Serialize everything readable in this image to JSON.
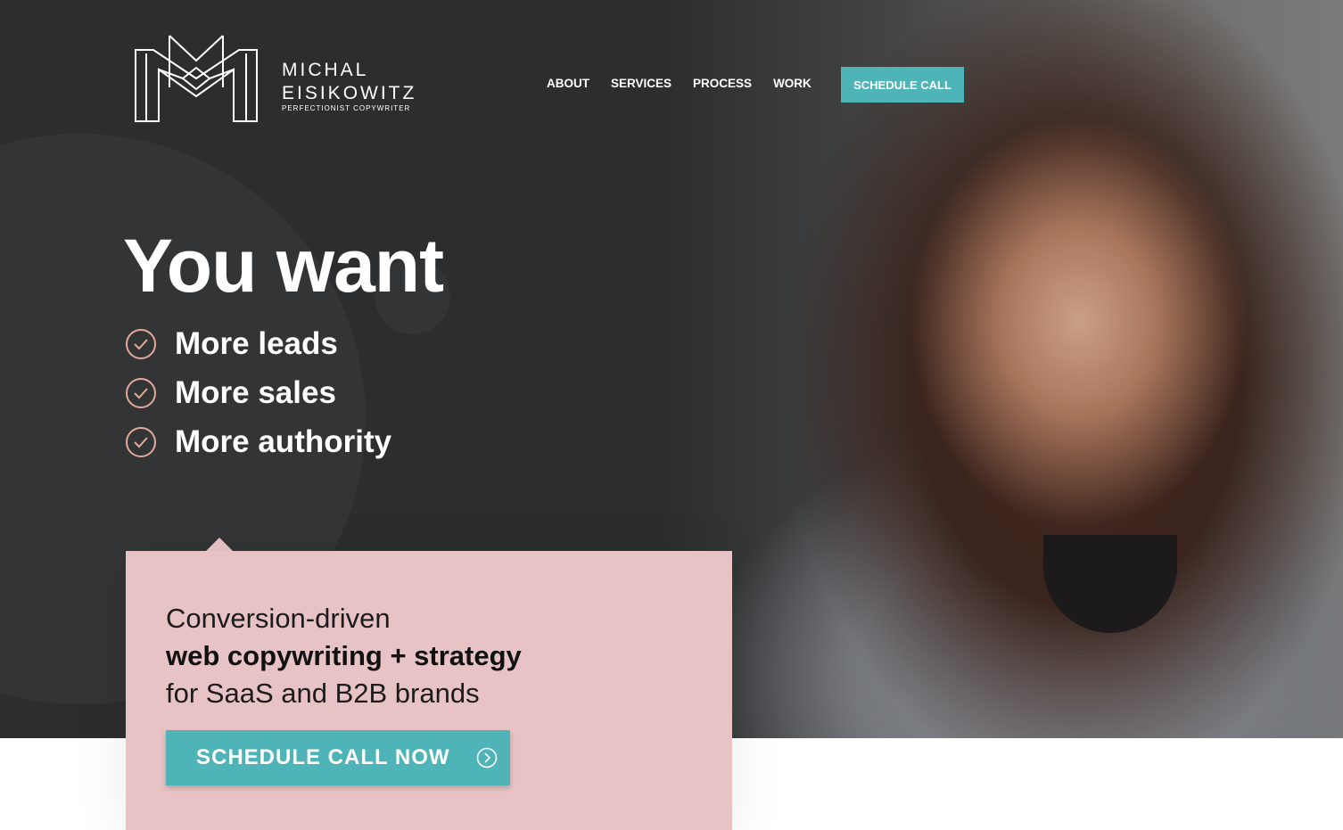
{
  "brand": {
    "name_line1": "MICHAL",
    "name_line2": "EISIKOWITZ",
    "tagline": "PERFECTIONIST COPYWRITER",
    "logo_icon": "monogram-m-logo"
  },
  "nav": {
    "items": [
      "ABOUT",
      "SERVICES",
      "PROCESS",
      "WORK"
    ],
    "cta_label": "SCHEDULE CALL"
  },
  "hero": {
    "headline": "You want",
    "benefits": [
      "More leads",
      "More sales",
      "More authority"
    ],
    "benefit_icon": "check-circle-icon",
    "accent_color": "#4fb4b8",
    "check_color": "#e3a999"
  },
  "card": {
    "line1": "Conversion-driven",
    "line2": "web copywriting + strategy",
    "line3": "for SaaS and B2B brands",
    "cta_label": "SCHEDULE CALL NOW",
    "cta_icon": "chevron-right-circle-icon",
    "background": "#e8c3c5"
  }
}
